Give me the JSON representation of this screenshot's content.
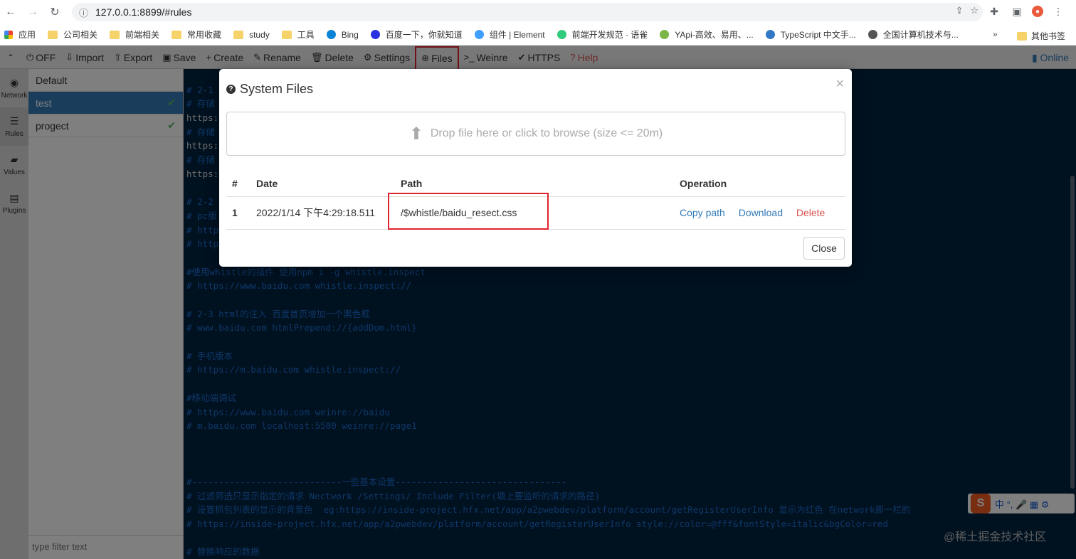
{
  "browser": {
    "url": "127.0.0.1:8899/#rules",
    "bookmarks": [
      {
        "label": "应用",
        "icon": "apps-icon"
      },
      {
        "label": "公司相关",
        "icon": "folder-icon"
      },
      {
        "label": "前端相关",
        "icon": "folder-icon"
      },
      {
        "label": "常用收藏",
        "icon": "folder-icon"
      },
      {
        "label": "study",
        "icon": "folder-icon"
      },
      {
        "label": "工具",
        "icon": "folder-icon"
      },
      {
        "label": "Bing",
        "icon": "bing-icon"
      },
      {
        "label": "百度一下，你就知道",
        "icon": "baidu-icon"
      },
      {
        "label": "组件 | Element",
        "icon": "element-icon"
      },
      {
        "label": "前端开发规范 · 语雀",
        "icon": "yuque-icon"
      },
      {
        "label": "YApi-高效、易用、...",
        "icon": "yapi-icon"
      },
      {
        "label": "TypeScript 中文手...",
        "icon": "ts-icon"
      },
      {
        "label": "全国计算机技术与...",
        "icon": "globe-icon"
      }
    ],
    "more": "»",
    "other_bookmarks": "其他书签"
  },
  "toolbar": {
    "items": [
      {
        "icon": "power-icon",
        "glyph": "⏻",
        "label": "OFF"
      },
      {
        "icon": "import-icon",
        "glyph": "⇩",
        "label": "Import"
      },
      {
        "icon": "export-icon",
        "glyph": "⇧",
        "label": "Export"
      },
      {
        "icon": "save-icon",
        "glyph": "▣",
        "label": "Save"
      },
      {
        "icon": "plus-icon",
        "glyph": "+",
        "label": "Create"
      },
      {
        "icon": "edit-icon",
        "glyph": "✎",
        "label": "Rename"
      },
      {
        "icon": "trash-icon",
        "glyph": "🗑",
        "label": "Delete"
      },
      {
        "icon": "gear-icon",
        "glyph": "⚙",
        "label": "Settings"
      },
      {
        "icon": "upload-circle-icon",
        "glyph": "⊕",
        "label": "Files"
      },
      {
        "icon": "terminal-icon",
        "glyph": ">_",
        "label": "Weinre"
      },
      {
        "icon": "check-icon",
        "glyph": "✔",
        "label": "HTTPS"
      },
      {
        "icon": "question-icon",
        "glyph": "?",
        "label": "Help"
      }
    ],
    "online": "Online"
  },
  "rail": [
    {
      "label": "Network",
      "glyph": "◉"
    },
    {
      "label": "Rules",
      "glyph": "☰"
    },
    {
      "label": "Values",
      "glyph": "▰"
    },
    {
      "label": "Plugins",
      "glyph": "▤"
    }
  ],
  "rules": [
    {
      "name": "Default",
      "selected": false,
      "checked": false
    },
    {
      "name": "test",
      "selected": true,
      "checked": true
    },
    {
      "name": "progect",
      "selected": false,
      "checked": true
    }
  ],
  "filter_placeholder": "type filter text",
  "editor_lines": [
    {
      "t": "",
      "c": "plain"
    },
    {
      "t": "# 2-1",
      "c": "comment"
    },
    {
      "t": "# 存储",
      "c": "comment"
    },
    {
      "t": "https:",
      "c": "plain"
    },
    {
      "t": "# 存储",
      "c": "comment"
    },
    {
      "t": "https:",
      "c": "plain"
    },
    {
      "t": "# 存储",
      "c": "comment"
    },
    {
      "t": "https:",
      "c": "plain"
    },
    {
      "t": "",
      "c": "plain"
    },
    {
      "t": "# 2-2",
      "c": "comment"
    },
    {
      "t": "# pc版",
      "c": "comment"
    },
    {
      "t": "# http",
      "c": "comment"
    },
    {
      "t": "# http",
      "c": "comment"
    },
    {
      "t": "",
      "c": "plain"
    },
    {
      "t": "#使用whistle的插件 使用npm i -g whistle.inspect",
      "c": "comment"
    },
    {
      "t": "# https://www.baidu.com whistle.inspect://",
      "c": "comment"
    },
    {
      "t": "",
      "c": "plain"
    },
    {
      "t": "# 2-3 html的注入 百度首页增加一个黑色框",
      "c": "comment"
    },
    {
      "t": "# www.baidu.com htmlPrepend://{addDom.html}",
      "c": "comment"
    },
    {
      "t": "",
      "c": "plain"
    },
    {
      "t": "# 手机版本",
      "c": "comment"
    },
    {
      "t": "# https://m.baidu.com whistle.inspect://",
      "c": "comment"
    },
    {
      "t": "",
      "c": "plain"
    },
    {
      "t": "#移动端调试",
      "c": "comment"
    },
    {
      "t": "# https://www.baidu.com weinre://baidu",
      "c": "comment"
    },
    {
      "t": "# m.baidu.com localhost:5500 weinre://page1",
      "c": "comment"
    },
    {
      "t": "",
      "c": "plain"
    },
    {
      "t": "",
      "c": "plain"
    },
    {
      "t": "",
      "c": "plain"
    },
    {
      "t": "#----------------------------一些基本设置--------------------------------",
      "c": "comment"
    },
    {
      "t": "# 过滤筛选只显示指定的请求 Nectwork /Settings/ Include Filter(填上要监听的请求的路径)",
      "c": "comment"
    },
    {
      "t": "# 设置抓包列表的显示的背景色  eg:https://inside-project.hfx.net/app/a2pwebdev/platform/account/getRegisterUserInfo 显示为红色 在network那一栏的",
      "c": "comment"
    },
    {
      "t": "# https://inside-project.hfx.net/app/a2pwebdev/platform/account/getRegisterUserInfo style://color=@fff&fontStyle=italic&bgColor=red",
      "c": "comment"
    },
    {
      "t": "",
      "c": "plain"
    },
    {
      "t": "# 替换响应的数据",
      "c": "comment"
    }
  ],
  "watermark": "@稀土掘金技术社区",
  "ime": {
    "logo": "S",
    "text": "中 °, 🎤 ▦ ⚙"
  },
  "modal": {
    "title": "System Files",
    "dropzone": "Drop file here or click to browse (size <= 20m)",
    "columns": {
      "num": "#",
      "date": "Date",
      "path": "Path",
      "operation": "Operation"
    },
    "rows": [
      {
        "num": "1",
        "date": "2022/1/14 下午4:29:18.511",
        "path": "/$whistle/baidu_resect.css"
      }
    ],
    "ops": {
      "copy": "Copy path",
      "download": "Download",
      "delete": "Delete"
    },
    "close": "Close",
    "x": "×"
  }
}
